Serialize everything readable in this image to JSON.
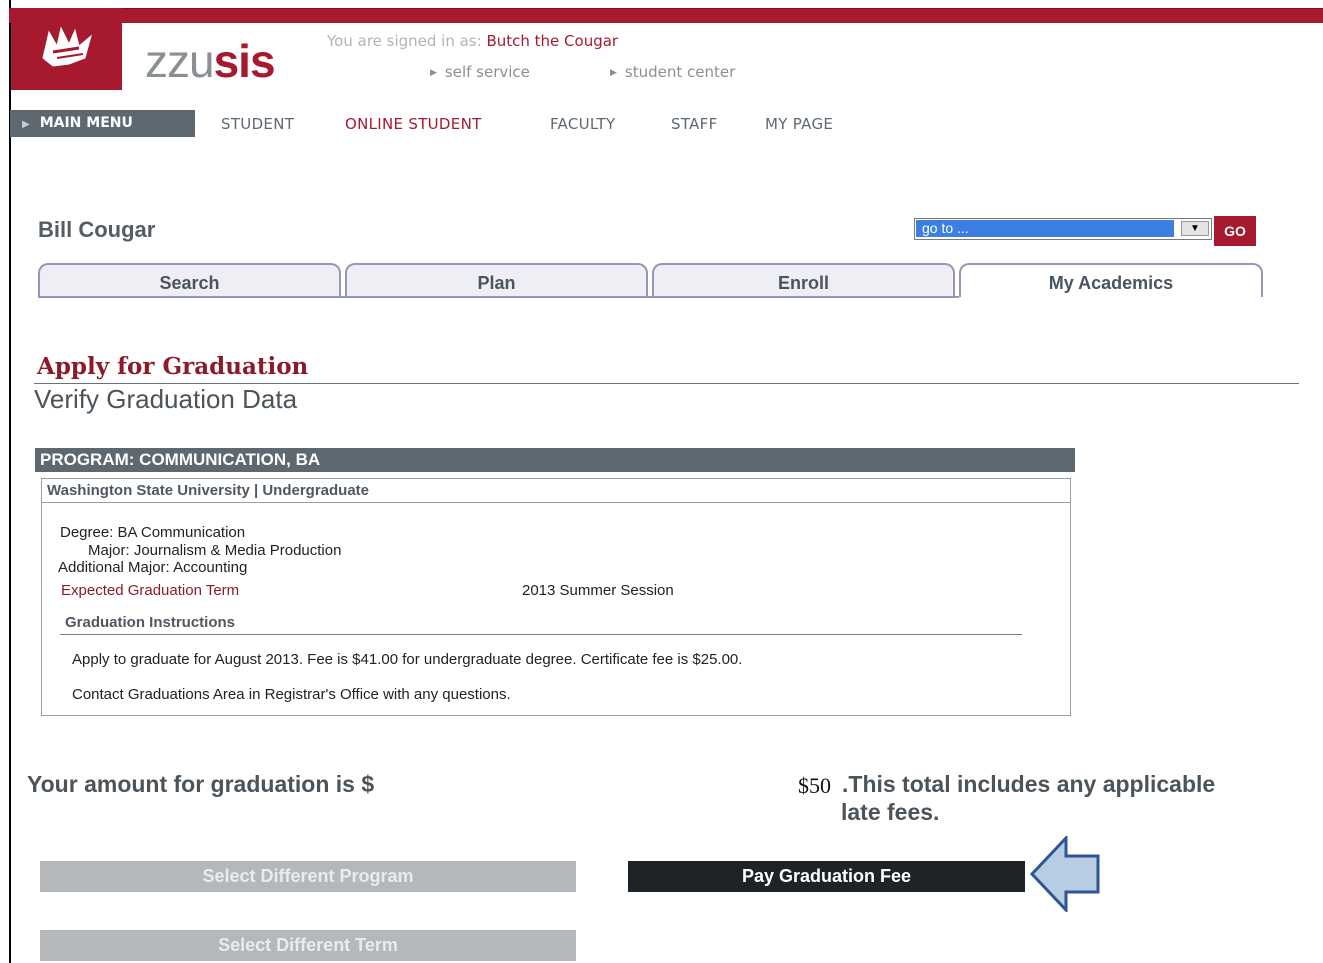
{
  "header": {
    "brand_prefix": "zzu",
    "brand_suffix": "sis",
    "signed_in_label": "You are signed in as:",
    "signed_in_user": "Butch the Cougar",
    "top_links": [
      "self service",
      "student center"
    ]
  },
  "nav": {
    "main_menu": "MAIN MENU",
    "items": [
      "STUDENT",
      "ONLINE STUDENT",
      "FACULTY",
      "STAFF",
      "MY PAGE"
    ],
    "active": "ONLINE STUDENT"
  },
  "student_name": "Bill Cougar",
  "goto": {
    "selected": "go to ...",
    "button": "GO"
  },
  "tabs": [
    "Search",
    "Plan",
    "Enroll",
    "My Academics"
  ],
  "selected_tab": "My Academics",
  "page": {
    "title": "Apply for Graduation",
    "subtitle": "Verify Graduation Data"
  },
  "program": {
    "header": "PROGRAM: COMMUNICATION, BA",
    "institution": "Washington State University | Undergraduate",
    "degree": "Degree: BA Communication",
    "major": "Major: Journalism & Media Production",
    "additional_major": "Additional Major: Accounting",
    "term_label": "Expected Graduation Term",
    "term_value": "2013 Summer Session",
    "instructions_header": "Graduation Instructions",
    "instructions": [
      "Apply to graduate for August 2013.  Fee is $41.00 for undergraduate degree.  Certificate fee is $25.00.",
      "Contact Graduations Area in Registrar's Office with any questions."
    ]
  },
  "amount": {
    "label": "Your amount for graduation is $",
    "value": "$50",
    "note_line1": ".This total includes any applicable",
    "note_line2": "late fees."
  },
  "buttons": {
    "select_program": "Select Different Program",
    "pay_fee": "Pay Graduation Fee",
    "select_term": "Select Different Term"
  },
  "colors": {
    "brand_red": "#a6192e",
    "slate": "#5e6870",
    "arrow_fill": "#b8cce4",
    "arrow_stroke": "#2f5597"
  }
}
